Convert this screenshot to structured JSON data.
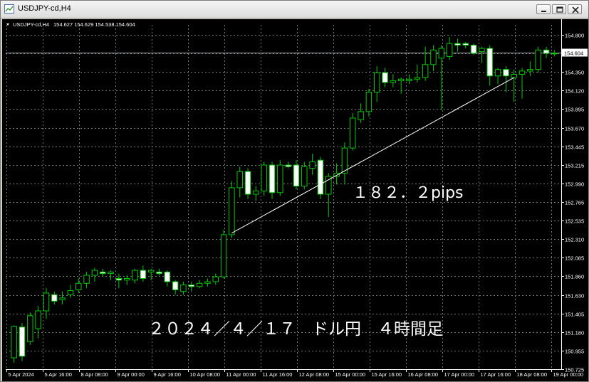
{
  "window": {
    "title": "USDJPY-cd,H4"
  },
  "chart_data": {
    "type": "candlestick",
    "symbol_label": "USDJPY-cd,H4",
    "ohlc_label": "154.627 154.629 154.538 154.604",
    "current_price_label": "154.604",
    "current_price": 154.604,
    "ylim": [
      150.7,
      154.95
    ],
    "y_ticks": [
      "154.800",
      "154.575",
      "154.350",
      "154.120",
      "153.895",
      "153.670",
      "153.445",
      "153.215",
      "152.990",
      "152.765",
      "152.535",
      "152.310",
      "152.085",
      "151.860",
      "151.630",
      "151.405",
      "151.180",
      "150.955",
      "150.725"
    ],
    "x_ticks": [
      "5 Apr 2024",
      "5 Apr 16:00",
      "8 Apr 08:00",
      "9 Apr 00:00",
      "9 Apr 16:00",
      "10 Apr 08:00",
      "11 Apr 00:00",
      "11 Apr 16:00",
      "12 Apr 08:00",
      "15 Apr 00:00",
      "15 Apr 16:00",
      "16 Apr 08:00",
      "17 Apr 00:00",
      "17 Apr 16:00",
      "18 Apr 08:00",
      "19 Apr 00:00"
    ],
    "candles": [
      {
        "o": 150.84,
        "h": 151.24,
        "l": 150.78,
        "c": 151.23
      },
      {
        "o": 151.22,
        "h": 151.27,
        "l": 150.8,
        "c": 150.86
      },
      {
        "o": 151.04,
        "h": 151.4,
        "l": 151.0,
        "c": 151.36
      },
      {
        "o": 151.2,
        "h": 151.48,
        "l": 151.08,
        "c": 151.42
      },
      {
        "o": 151.42,
        "h": 151.7,
        "l": 151.32,
        "c": 151.64
      },
      {
        "o": 151.62,
        "h": 151.66,
        "l": 151.5,
        "c": 151.54
      },
      {
        "o": 151.56,
        "h": 151.66,
        "l": 151.5,
        "c": 151.58
      },
      {
        "o": 151.62,
        "h": 151.74,
        "l": 151.58,
        "c": 151.67
      },
      {
        "o": 151.68,
        "h": 151.82,
        "l": 151.64,
        "c": 151.76
      },
      {
        "o": 151.76,
        "h": 151.9,
        "l": 151.7,
        "c": 151.86
      },
      {
        "o": 151.86,
        "h": 151.95,
        "l": 151.78,
        "c": 151.92
      },
      {
        "o": 151.9,
        "h": 151.94,
        "l": 151.84,
        "c": 151.88
      },
      {
        "o": 151.88,
        "h": 151.92,
        "l": 151.8,
        "c": 151.9
      },
      {
        "o": 151.82,
        "h": 151.88,
        "l": 151.7,
        "c": 151.8
      },
      {
        "o": 151.8,
        "h": 151.86,
        "l": 151.74,
        "c": 151.82
      },
      {
        "o": 151.8,
        "h": 151.94,
        "l": 151.76,
        "c": 151.92
      },
      {
        "o": 151.92,
        "h": 151.98,
        "l": 151.78,
        "c": 151.82
      },
      {
        "o": 151.9,
        "h": 151.94,
        "l": 151.8,
        "c": 151.92
      },
      {
        "o": 151.9,
        "h": 151.94,
        "l": 151.86,
        "c": 151.88
      },
      {
        "o": 151.9,
        "h": 151.92,
        "l": 151.72,
        "c": 151.78
      },
      {
        "o": 151.78,
        "h": 151.8,
        "l": 151.62,
        "c": 151.68
      },
      {
        "o": 151.66,
        "h": 151.78,
        "l": 151.62,
        "c": 151.74
      },
      {
        "o": 151.74,
        "h": 151.78,
        "l": 151.66,
        "c": 151.72
      },
      {
        "o": 151.72,
        "h": 151.8,
        "l": 151.7,
        "c": 151.76
      },
      {
        "o": 151.76,
        "h": 151.82,
        "l": 151.72,
        "c": 151.78
      },
      {
        "o": 151.78,
        "h": 151.88,
        "l": 151.74,
        "c": 151.84
      },
      {
        "o": 151.84,
        "h": 152.42,
        "l": 151.82,
        "c": 152.36
      },
      {
        "o": 152.36,
        "h": 153.02,
        "l": 152.32,
        "c": 152.94
      },
      {
        "o": 152.94,
        "h": 153.2,
        "l": 152.82,
        "c": 153.14
      },
      {
        "o": 153.14,
        "h": 153.18,
        "l": 152.8,
        "c": 152.86
      },
      {
        "o": 152.86,
        "h": 152.96,
        "l": 152.78,
        "c": 152.9
      },
      {
        "o": 152.9,
        "h": 153.26,
        "l": 152.84,
        "c": 153.22
      },
      {
        "o": 153.22,
        "h": 153.26,
        "l": 152.8,
        "c": 152.88
      },
      {
        "o": 152.88,
        "h": 153.28,
        "l": 152.84,
        "c": 153.22
      },
      {
        "o": 153.22,
        "h": 153.26,
        "l": 153.18,
        "c": 153.2
      },
      {
        "o": 153.22,
        "h": 153.28,
        "l": 152.92,
        "c": 152.96
      },
      {
        "o": 152.96,
        "h": 153.26,
        "l": 152.92,
        "c": 153.2
      },
      {
        "o": 153.18,
        "h": 153.36,
        "l": 153.1,
        "c": 153.26
      },
      {
        "o": 153.28,
        "h": 153.32,
        "l": 152.8,
        "c": 152.86
      },
      {
        "o": 152.86,
        "h": 153.12,
        "l": 152.58,
        "c": 153.08
      },
      {
        "o": 153.08,
        "h": 153.24,
        "l": 152.98,
        "c": 153.12
      },
      {
        "o": 153.12,
        "h": 153.5,
        "l": 152.98,
        "c": 153.43
      },
      {
        "o": 153.43,
        "h": 153.86,
        "l": 153.4,
        "c": 153.8
      },
      {
        "o": 153.78,
        "h": 153.98,
        "l": 153.74,
        "c": 153.88
      },
      {
        "o": 153.88,
        "h": 154.16,
        "l": 153.82,
        "c": 154.12
      },
      {
        "o": 154.12,
        "h": 154.44,
        "l": 154.0,
        "c": 154.36
      },
      {
        "o": 154.36,
        "h": 154.42,
        "l": 154.18,
        "c": 154.24
      },
      {
        "o": 154.24,
        "h": 154.34,
        "l": 154.18,
        "c": 154.26
      },
      {
        "o": 154.26,
        "h": 154.3,
        "l": 154.1,
        "c": 154.28
      },
      {
        "o": 154.26,
        "h": 154.34,
        "l": 154.22,
        "c": 154.28
      },
      {
        "o": 154.28,
        "h": 154.46,
        "l": 154.24,
        "c": 154.3
      },
      {
        "o": 154.3,
        "h": 154.68,
        "l": 154.26,
        "c": 154.46
      },
      {
        "o": 154.46,
        "h": 154.7,
        "l": 154.38,
        "c": 154.64
      },
      {
        "o": 154.54,
        "h": 154.7,
        "l": 153.9,
        "c": 154.66
      },
      {
        "o": 154.56,
        "h": 154.8,
        "l": 154.52,
        "c": 154.72
      },
      {
        "o": 154.72,
        "h": 154.78,
        "l": 154.62,
        "c": 154.7
      },
      {
        "o": 154.72,
        "h": 154.74,
        "l": 154.66,
        "c": 154.7
      },
      {
        "o": 154.7,
        "h": 154.72,
        "l": 154.58,
        "c": 154.6
      },
      {
        "o": 154.62,
        "h": 154.68,
        "l": 154.48,
        "c": 154.66
      },
      {
        "o": 154.66,
        "h": 154.7,
        "l": 154.2,
        "c": 154.32
      },
      {
        "o": 154.32,
        "h": 154.42,
        "l": 154.22,
        "c": 154.4
      },
      {
        "o": 154.4,
        "h": 154.44,
        "l": 154.12,
        "c": 154.32
      },
      {
        "o": 154.3,
        "h": 154.4,
        "l": 154.0,
        "c": 154.34
      },
      {
        "o": 154.34,
        "h": 154.42,
        "l": 154.04,
        "c": 154.38
      },
      {
        "o": 154.38,
        "h": 154.5,
        "l": 154.32,
        "c": 154.4
      },
      {
        "o": 154.4,
        "h": 154.68,
        "l": 154.36,
        "c": 154.64
      },
      {
        "o": 154.64,
        "h": 154.68,
        "l": 154.54,
        "c": 154.6
      },
      {
        "o": 154.6,
        "h": 154.64,
        "l": 154.56,
        "c": 154.6
      }
    ],
    "trend_line": {
      "from": {
        "candle": 27,
        "price": 152.38
      },
      "to": {
        "candle": 62,
        "price": 154.3
      }
    },
    "annotations": [
      "１８２．２pips",
      "２０２４／４／１７　ドル円　４時間足"
    ],
    "grid": true,
    "colors": {
      "background": "#000000",
      "bull_fill": "#000000",
      "bear_fill": "#ffffff",
      "wick": "#00c800",
      "grid": "#6e7a6e",
      "axis_text": "#ffffff",
      "price_line": "#9aa0a6",
      "trend_line": "#ffffff"
    }
  }
}
